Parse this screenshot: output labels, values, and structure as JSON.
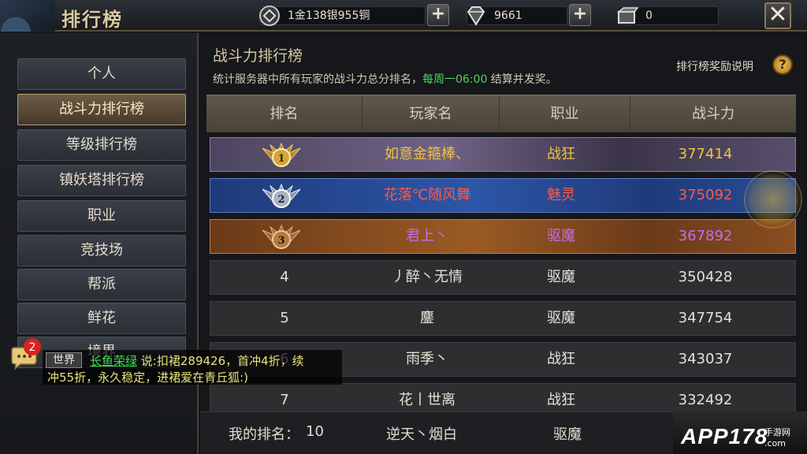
{
  "header": {
    "title": "排行榜",
    "currency": "1金138银955铜",
    "diamonds": "9661",
    "items": "0",
    "close_icon": "close-icon"
  },
  "nav": {
    "items": [
      {
        "label": "个人",
        "active": false
      },
      {
        "label": "战斗力排行榜",
        "active": true
      },
      {
        "label": "等级排行榜",
        "active": false
      },
      {
        "label": "镇妖塔排行榜",
        "active": false
      },
      {
        "label": "职业",
        "active": false
      },
      {
        "label": "竞技场",
        "active": false
      },
      {
        "label": "帮派",
        "active": false
      },
      {
        "label": "鲜花",
        "active": false
      },
      {
        "label": "境界",
        "active": false
      }
    ]
  },
  "panel": {
    "title": "战斗力排行榜",
    "desc_prefix": "统计服务器中所有玩家的战斗力总分排名，",
    "desc_highlight": "每周一06:00",
    "desc_suffix": " 结算并发奖。",
    "reward_link": "排行榜奖励说明",
    "help": "?"
  },
  "table": {
    "headers": [
      "排名",
      "玩家名",
      "职业",
      "战斗力"
    ],
    "rows": [
      {
        "rank": "1",
        "name": "如意金箍棒、",
        "class": "战狂",
        "power": "377414"
      },
      {
        "rank": "2",
        "name": "花落℃随风舞",
        "class": "魅灵",
        "power": "375092"
      },
      {
        "rank": "3",
        "name": "君上丶",
        "class": "驱魔",
        "power": "367892"
      },
      {
        "rank": "4",
        "name": "丿醉丶无情",
        "class": "驱魔",
        "power": "350428"
      },
      {
        "rank": "5",
        "name": "鏖",
        "class": "驱魔",
        "power": "347754"
      },
      {
        "rank": "6",
        "name": "雨季丶",
        "class": "战狂",
        "power": "343037"
      },
      {
        "rank": "7",
        "name": "花丨世离",
        "class": "战狂",
        "power": "332492"
      }
    ]
  },
  "my_rank": {
    "label": "我的排名：",
    "rank": "10",
    "name": "逆天丶烟白",
    "class": "驱魔"
  },
  "chat": {
    "badge": "2",
    "channel": "世界",
    "user": "长鱼荣绿",
    "line1": "说:扣裙289426，首冲4折，续",
    "line2": "冲55折，永久稳定，进裙爱在青丘狐:)"
  },
  "watermark": {
    "text": "APP178",
    "sub": "手游网",
    "domain": ".com"
  }
}
